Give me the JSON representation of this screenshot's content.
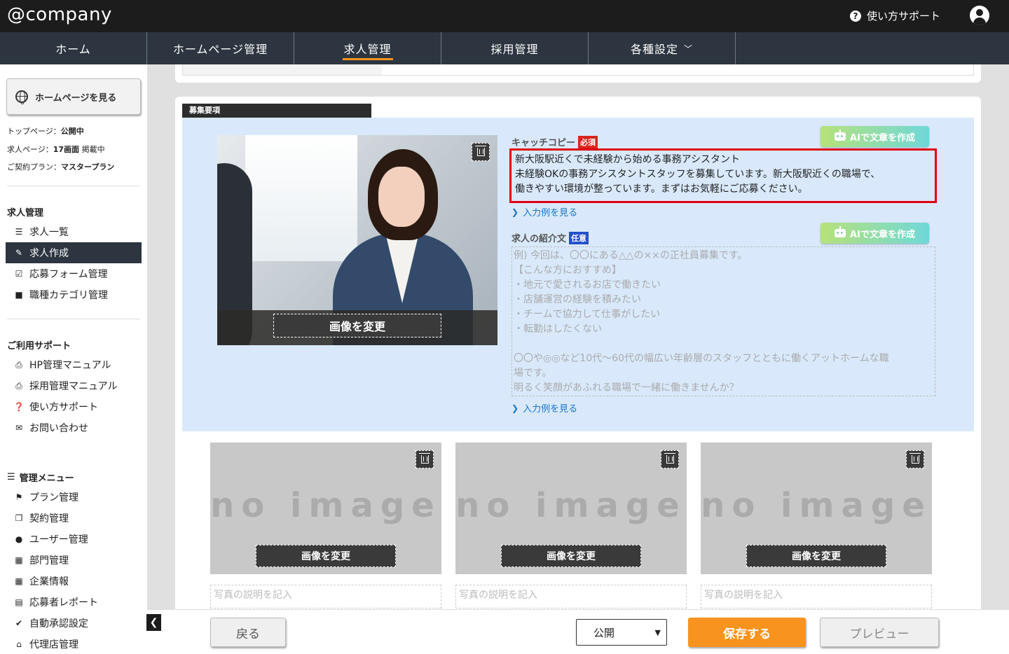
{
  "header": {
    "logo": "@company",
    "help_label": "使い方サポート"
  },
  "nav": {
    "tabs": [
      {
        "label": "ホーム"
      },
      {
        "label": "ホームページ管理"
      },
      {
        "label": "求人管理",
        "active": true
      },
      {
        "label": "採用管理"
      },
      {
        "label": "各種設定",
        "dropdown": true
      }
    ]
  },
  "sidebar": {
    "view_hp_button": "ホームページを見る",
    "status": {
      "top_page_label": "トップページ：",
      "top_page_value": "公開中",
      "job_page_label": "求人ページ：",
      "job_page_count": "17画面",
      "job_page_state": "掲載中",
      "plan_label": "ご契約プラン：",
      "plan_value": "マスタープラン"
    },
    "job_section": {
      "title": "求人管理",
      "items": [
        {
          "label": "求人一覧",
          "icon": "list-icon"
        },
        {
          "label": "求人作成",
          "icon": "edit-icon",
          "active": true
        },
        {
          "label": "応募フォーム管理",
          "icon": "checkbox-icon"
        },
        {
          "label": "職種カテゴリ管理",
          "icon": "briefcase-icon"
        }
      ]
    },
    "support_section": {
      "title": "ご利用サポート",
      "items": [
        {
          "label": "HP管理マニュアル",
          "icon": "pdf-icon"
        },
        {
          "label": "採用管理マニュアル",
          "icon": "pdf-icon"
        },
        {
          "label": "使い方サポート",
          "icon": "question-icon"
        },
        {
          "label": "お問い合わせ",
          "icon": "mail-icon"
        }
      ]
    },
    "admin_section": {
      "title": "管理メニュー",
      "items": [
        {
          "label": "プラン管理",
          "icon": "flag-icon"
        },
        {
          "label": "契約管理",
          "icon": "copy-icon"
        },
        {
          "label": "ユーザー管理",
          "icon": "user-icon"
        },
        {
          "label": "部門管理",
          "icon": "building-icon"
        },
        {
          "label": "企業情報",
          "icon": "building-icon"
        },
        {
          "label": "応募者レポート",
          "icon": "id-card-icon"
        },
        {
          "label": "自動承認設定",
          "icon": "check-circle-icon"
        },
        {
          "label": "代理店管理",
          "icon": "bank-icon"
        }
      ]
    }
  },
  "main": {
    "section_label": "募集要項",
    "change_image_label": "画像を変更",
    "catch_copy": {
      "label": "キャッチコピー",
      "badge": "必須",
      "ai_button": "AIで文章を作成",
      "lines": [
        "新大阪駅近くで未経験から始める事務アシスタント",
        "未経験OKの事務アシスタントスタッフを募集しています。新大阪駅近くの職場で、",
        "働きやすい環境が整っています。まずはお気軽にご応募ください。"
      ],
      "example_link": "入力例を見る"
    },
    "intro": {
      "label": "求人の紹介文",
      "badge": "任意",
      "ai_button": "AIで文章を作成",
      "placeholder_lines": [
        "例) 今回は、〇〇にある△△の××の正社員募集です。",
        "【こんな方におすすめ】",
        "・地元で愛されるお店で働きたい",
        "・店舗運営の経験を積みたい",
        "・チームで協力して仕事がしたい",
        "・転勤はしたくない",
        "",
        "〇〇や◎◎など10代〜60代の幅広い年齢層のスタッフとともに働くアットホームな職",
        "場です。",
        "明るく笑顔があふれる職場で一緒に働きませんか？"
      ],
      "example_link": "入力例を見る"
    },
    "thumbnails": [
      {
        "no_image": "no image",
        "change_label": "画像を変更",
        "caption_placeholder": "写真の説明を記入"
      },
      {
        "no_image": "no image",
        "change_label": "画像を変更",
        "caption_placeholder": "写真の説明を記入"
      },
      {
        "no_image": "no image",
        "change_label": "画像を変更",
        "caption_placeholder": "写真の説明を記入"
      }
    ]
  },
  "footer": {
    "back_label": "戻る",
    "visibility_value": "公開",
    "save_label": "保存する",
    "preview_label": "プレビュー"
  },
  "colors": {
    "accent": "#f7931e",
    "nav_bg": "#2c3540",
    "required": "#d9251d",
    "optional": "#2650c8",
    "highlight_border": "#e00012"
  }
}
